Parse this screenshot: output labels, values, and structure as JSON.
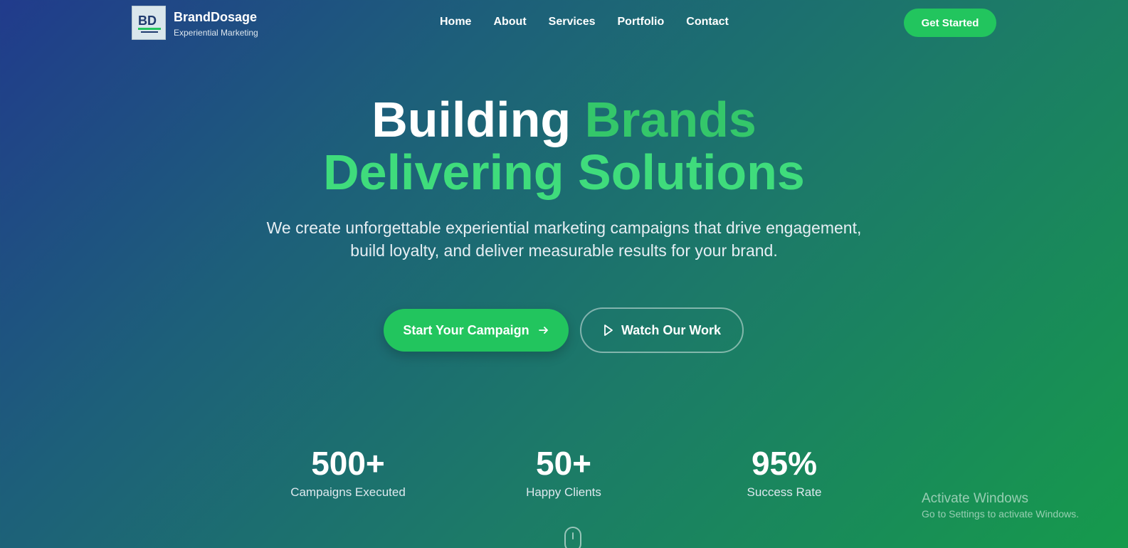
{
  "brand": {
    "name": "BrandDosage",
    "tagline": "Experiential Marketing"
  },
  "nav": {
    "links": [
      "Home",
      "About",
      "Services",
      "Portfolio",
      "Contact"
    ],
    "cta_label": "Get Started"
  },
  "hero": {
    "title_part1": "Building",
    "title_highlight": "Brands",
    "title_line2": "Delivering Solutions",
    "subtitle_line1": "We create unforgettable experiential marketing campaigns that drive engagement,",
    "subtitle_line2": "build loyalty, and deliver measurable results for your brand.",
    "primary_button": "Start Your Campaign",
    "secondary_button": "Watch Our Work"
  },
  "stats": [
    {
      "value": "500+",
      "label": "Campaigns Executed"
    },
    {
      "value": "50+",
      "label": "Happy Clients"
    },
    {
      "value": "95%",
      "label": "Success Rate"
    }
  ],
  "watermark": {
    "title": "Activate Windows",
    "subtitle": "Go to Settings to activate Windows."
  },
  "colors": {
    "accent": "#22c55e",
    "highlight": "#3fdc7c",
    "gradient_start": "#213b8c",
    "gradient_end": "#169a4c"
  }
}
